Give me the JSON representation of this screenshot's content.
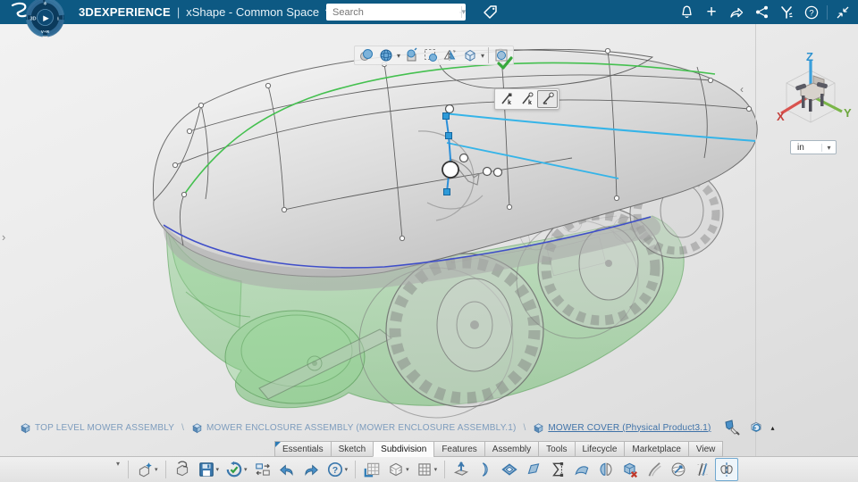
{
  "colors": {
    "topbar": "#0d5983",
    "accent_blue": "#2e7bb5",
    "selection_cyan": "#35b4e8",
    "edge_blue": "#3f4ec9",
    "curve_green": "#44c04f",
    "shell_green": "#6ebe6e",
    "confirm_green": "#37a93c",
    "axis_x_red": "#d9534f",
    "axis_y_green": "#7ab648",
    "axis_z_blue": "#3aa0dc"
  },
  "top_bar": {
    "brand": "3DEXPERIENCE",
    "pipe": "|",
    "app_title": "xShape - Common Space",
    "caret": "▾",
    "compass": {
      "left": "3D",
      "bottom": "V+R",
      "play": "▶"
    },
    "search": {
      "placeholder": "Search",
      "caret": "▾"
    },
    "icons": {
      "tag": "tag",
      "notifications": "notifications bell",
      "add": "add",
      "share_arrow": "share",
      "share_network": "share network",
      "swym": "3DSwym",
      "help": "help",
      "collapse": "collapse window"
    },
    "add_glyph": "+",
    "help_glyph": "?"
  },
  "viewport_toolbar": {
    "items": [
      {
        "name": "display-mode-shaded"
      },
      {
        "name": "display-mode-material",
        "caret": "▾"
      },
      {
        "name": "reframe-on-selection"
      },
      {
        "name": "hide-show-selection"
      },
      {
        "name": "mirror-display"
      },
      {
        "name": "view-cube",
        "caret": "▾"
      },
      {
        "name": "ok-confirm"
      }
    ]
  },
  "edit_mode_toolbar": {
    "items": [
      {
        "name": "edit-point-kink-a"
      },
      {
        "name": "edit-point-kink-b"
      },
      {
        "name": "edit-point-smooth"
      }
    ],
    "active_index": 2
  },
  "axis_triad": {
    "x": "X",
    "y": "Y",
    "z": "Z"
  },
  "units": {
    "value": "in",
    "caret": "▾"
  },
  "breadcrumb": {
    "separator": "\\",
    "items": [
      {
        "label": "TOP LEVEL MOWER ASSEMBLY"
      },
      {
        "label": "MOWER ENCLOSURE ASSEMBLY (MOWER ENCLOSURE ASSEMBLY.1)"
      },
      {
        "label": "MOWER COVER (Physical Product3.1)"
      }
    ],
    "actions": [
      {
        "name": "explore-with-pencil"
      },
      {
        "name": "update-product"
      }
    ],
    "more_glyph": "▴"
  },
  "tabs": {
    "active": "Subdivision",
    "items": [
      {
        "label": "Essentials"
      },
      {
        "label": "Sketch"
      },
      {
        "label": "Subdivision"
      },
      {
        "label": "Features"
      },
      {
        "label": "Assembly"
      },
      {
        "label": "Tools"
      },
      {
        "label": "Lifecycle"
      },
      {
        "label": "Marketplace"
      },
      {
        "label": "View"
      }
    ]
  },
  "bottom_toolbar": {
    "expander_glyph": "▾",
    "caret_glyph": "▾",
    "items": [
      {
        "name": "new-content",
        "caret": true
      },
      {
        "name": "open"
      },
      {
        "name": "save",
        "caret": true
      },
      {
        "name": "save-and-update",
        "caret": true
      },
      {
        "name": "swap-references"
      },
      {
        "name": "undo"
      },
      {
        "name": "redo"
      },
      {
        "name": "help-commands",
        "caret": true
      },
      {
        "name": "work-on-support-grid"
      },
      {
        "name": "primitive-box",
        "caret": true
      },
      {
        "name": "modification-grid",
        "caret": true
      },
      {
        "name": "extrude-face"
      },
      {
        "name": "bend-curve"
      },
      {
        "name": "insert-loop"
      },
      {
        "name": "create-face"
      },
      {
        "name": "align-points"
      },
      {
        "name": "match-surface"
      },
      {
        "name": "subdivision-weight"
      },
      {
        "name": "erase-face"
      },
      {
        "name": "curvature-flow"
      },
      {
        "name": "project-on-sphere"
      },
      {
        "name": "duplicate-offset"
      },
      {
        "name": "symmetry",
        "active": true
      }
    ]
  }
}
